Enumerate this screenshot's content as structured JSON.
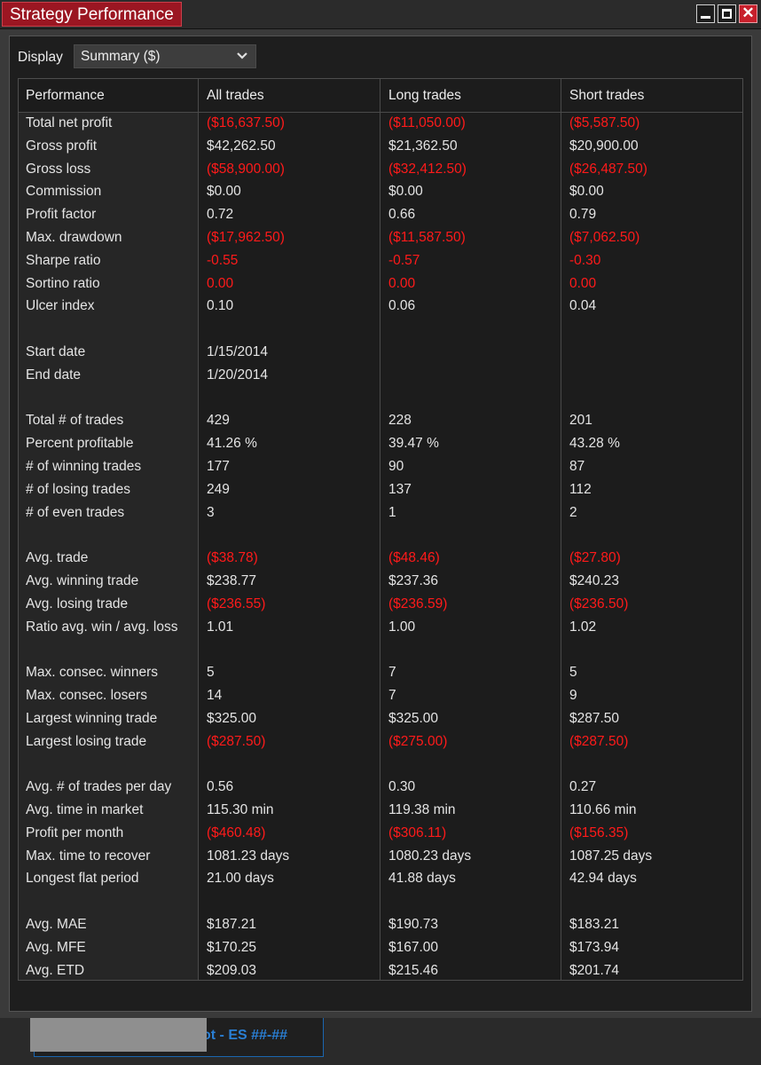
{
  "window": {
    "title": "Strategy Performance"
  },
  "display": {
    "label": "Display",
    "selected": "Summary ($)"
  },
  "columns": [
    "Performance",
    "All trades",
    "Long trades",
    "Short trades"
  ],
  "rows": [
    {
      "label": "Total net profit",
      "values": [
        "($16,637.50)",
        "($11,050.00)",
        "($5,587.50)"
      ],
      "neg": true
    },
    {
      "label": "Gross profit",
      "values": [
        "$42,262.50",
        "$21,362.50",
        "$20,900.00"
      ],
      "neg": false
    },
    {
      "label": "Gross loss",
      "values": [
        "($58,900.00)",
        "($32,412.50)",
        "($26,487.50)"
      ],
      "neg": true
    },
    {
      "label": "Commission",
      "values": [
        "$0.00",
        "$0.00",
        "$0.00"
      ],
      "neg": false
    },
    {
      "label": "Profit factor",
      "values": [
        "0.72",
        "0.66",
        "0.79"
      ],
      "neg": false
    },
    {
      "label": "Max. drawdown",
      "values": [
        "($17,962.50)",
        "($11,587.50)",
        "($7,062.50)"
      ],
      "neg": true
    },
    {
      "label": "Sharpe ratio",
      "values": [
        "-0.55",
        "-0.57",
        "-0.30"
      ],
      "neg": true
    },
    {
      "label": "Sortino ratio",
      "values": [
        "0.00",
        "0.00",
        "0.00"
      ],
      "neg": true
    },
    {
      "label": "Ulcer index",
      "values": [
        "0.10",
        "0.06",
        "0.04"
      ],
      "neg": false
    },
    null,
    {
      "label": "Start date",
      "values": [
        "1/15/2014",
        "",
        ""
      ],
      "neg": false
    },
    {
      "label": "End date",
      "values": [
        "1/20/2014",
        "",
        ""
      ],
      "neg": false
    },
    null,
    {
      "label": "Total # of trades",
      "values": [
        "429",
        "228",
        "201"
      ],
      "neg": false
    },
    {
      "label": "Percent profitable",
      "values": [
        "41.26 %",
        "39.47 %",
        "43.28 %"
      ],
      "neg": false
    },
    {
      "label": "# of winning trades",
      "values": [
        "177",
        "90",
        "87"
      ],
      "neg": false
    },
    {
      "label": "# of losing trades",
      "values": [
        "249",
        "137",
        "112"
      ],
      "neg": false
    },
    {
      "label": "# of even trades",
      "values": [
        "3",
        "1",
        "2"
      ],
      "neg": false
    },
    null,
    {
      "label": "Avg. trade",
      "values": [
        "($38.78)",
        "($48.46)",
        "($27.80)"
      ],
      "neg": true
    },
    {
      "label": "Avg. winning trade",
      "values": [
        "$238.77",
        "$237.36",
        "$240.23"
      ],
      "neg": false
    },
    {
      "label": "Avg. losing trade",
      "values": [
        "($236.55)",
        "($236.59)",
        "($236.50)"
      ],
      "neg": true
    },
    {
      "label": "Ratio avg. win / avg. loss",
      "values": [
        "1.01",
        "1.00",
        "1.02"
      ],
      "neg": false
    },
    null,
    {
      "label": "Max. consec. winners",
      "values": [
        "5",
        "7",
        "5"
      ],
      "neg": false
    },
    {
      "label": "Max. consec. losers",
      "values": [
        "14",
        "7",
        "9"
      ],
      "neg": false
    },
    {
      "label": "Largest winning trade",
      "values": [
        "$325.00",
        "$325.00",
        "$287.50"
      ],
      "neg": false
    },
    {
      "label": "Largest losing trade",
      "values": [
        "($287.50)",
        "($275.00)",
        "($287.50)"
      ],
      "neg": true
    },
    null,
    {
      "label": "Avg. # of trades per day",
      "values": [
        "0.56",
        "0.30",
        "0.27"
      ],
      "neg": false
    },
    {
      "label": "Avg. time in market",
      "values": [
        "115.30 min",
        "119.38 min",
        "110.66 min"
      ],
      "neg": false
    },
    {
      "label": "Profit per month",
      "values": [
        "($460.48)",
        "($306.11)",
        "($156.35)"
      ],
      "neg": true
    },
    {
      "label": "Max. time to recover",
      "values": [
        "1081.23 days",
        "1080.23 days",
        "1087.25 days"
      ],
      "neg": false
    },
    {
      "label": "Longest flat period",
      "values": [
        "21.00 days",
        "41.88 days",
        "42.94 days"
      ],
      "neg": false
    },
    null,
    {
      "label": "Avg. MAE",
      "values": [
        "$187.21",
        "$190.73",
        "$183.21"
      ],
      "neg": false
    },
    {
      "label": "Avg. MFE",
      "values": [
        "$170.25",
        "$167.00",
        "$173.94"
      ],
      "neg": false
    },
    {
      "label": "Avg. ETD",
      "values": [
        "$209.03",
        "$215.46",
        "$201.74"
      ],
      "neg": false
    }
  ],
  "bottom_tab": {
    "text": "ot - ES ##-##"
  }
}
